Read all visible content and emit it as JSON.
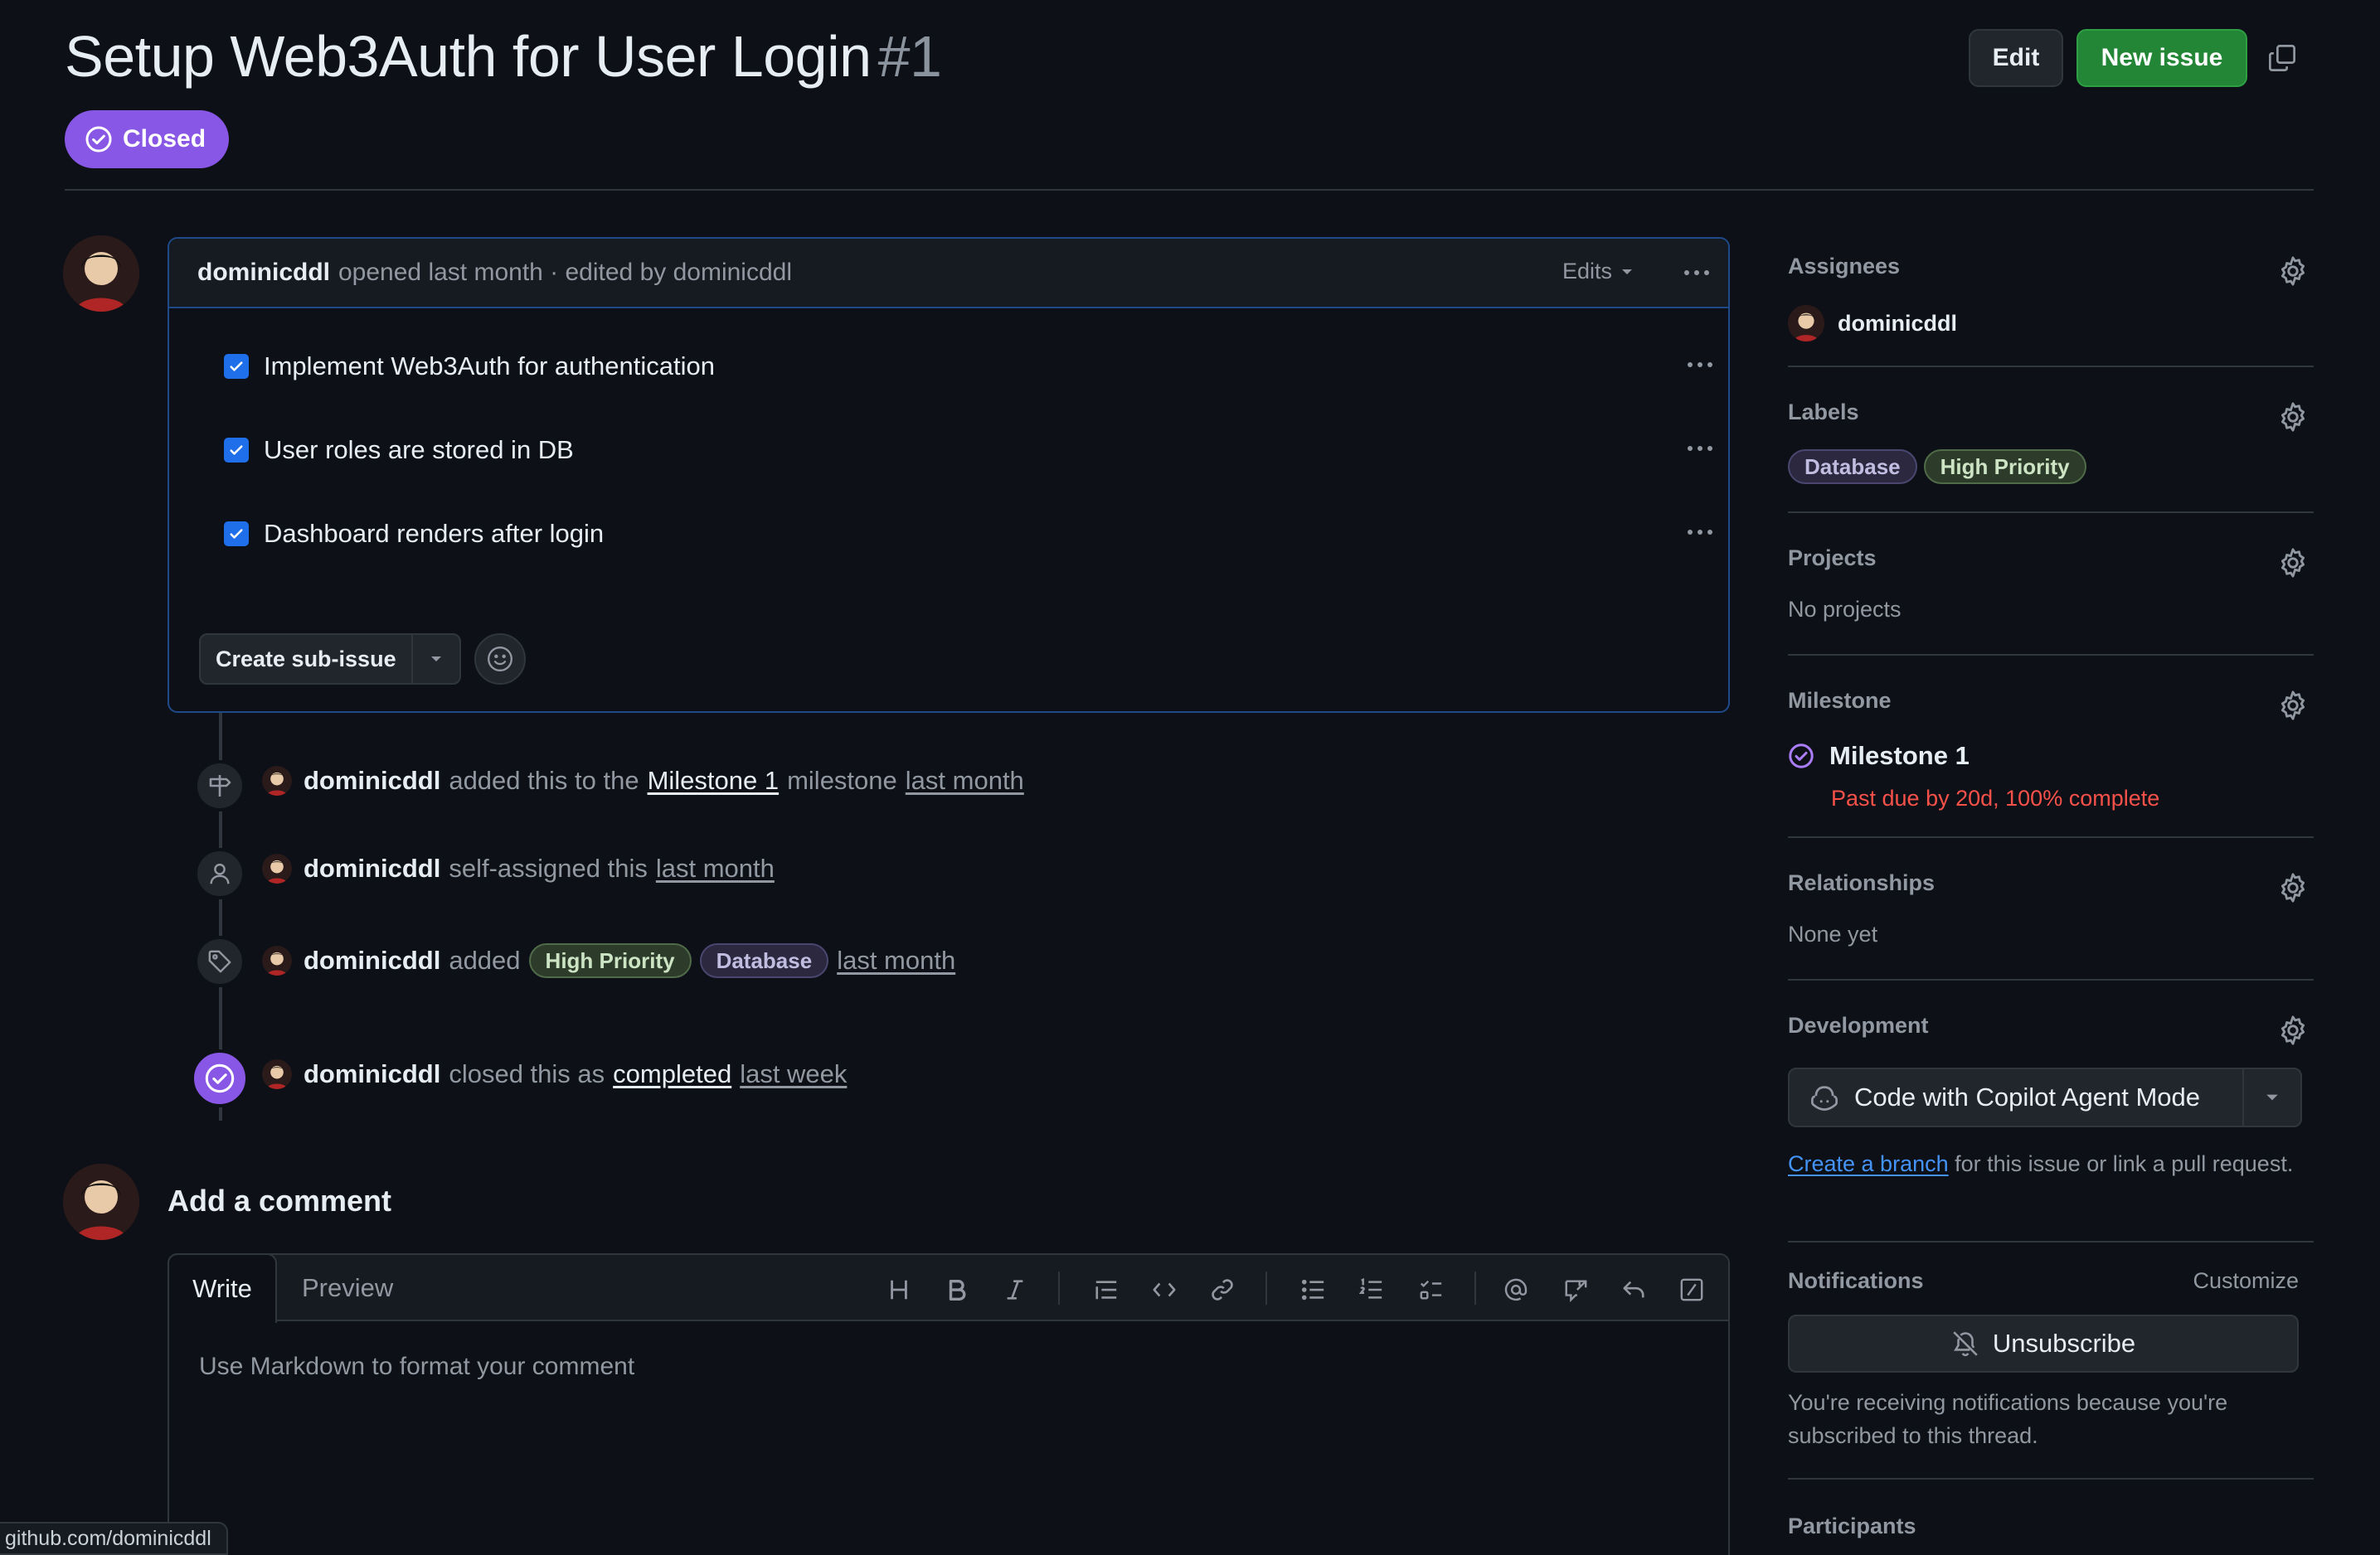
{
  "issue": {
    "title": "Setup Web3Auth for User Login",
    "number": "#1",
    "state": "Closed"
  },
  "header": {
    "edit_label": "Edit",
    "new_issue_label": "New issue"
  },
  "comment": {
    "author": "dominicddl",
    "meta": "opened last month · edited by dominicddl",
    "edits_label": "Edits",
    "tasks": [
      {
        "label": "Implement Web3Auth for authentication",
        "checked": true
      },
      {
        "label": "User roles are stored in DB",
        "checked": true
      },
      {
        "label": "Dashboard renders after login",
        "checked": true
      }
    ],
    "create_sub_issue_label": "Create sub-issue"
  },
  "timeline": {
    "milestone_event": {
      "actor": "dominicddl",
      "text_before": "added this to the",
      "milestone": "Milestone 1",
      "text_after": "milestone",
      "time": "last month"
    },
    "assign_event": {
      "actor": "dominicddl",
      "text": "self-assigned this",
      "time": "last month"
    },
    "label_event": {
      "actor": "dominicddl",
      "text": "added",
      "labels": [
        "High Priority",
        "Database"
      ],
      "time": "last month"
    },
    "close_event": {
      "actor": "dominicddl",
      "text": "closed this as",
      "reason": "completed",
      "time": "last week"
    }
  },
  "add_comment": {
    "title": "Add a comment",
    "tab_write": "Write",
    "tab_preview": "Preview",
    "placeholder": "Use Markdown to format your comment",
    "toolbar_icons": [
      "heading-icon",
      "bold-icon",
      "italic-icon",
      "quote-icon",
      "code-icon",
      "link-icon",
      "unordered-list-icon",
      "ordered-list-icon",
      "task-list-icon",
      "mention-icon",
      "reference-icon",
      "saved-reply-icon",
      "slash-command-icon"
    ]
  },
  "sidebar": {
    "assignees": {
      "title": "Assignees",
      "user": "dominicddl"
    },
    "labels": {
      "title": "Labels",
      "items": [
        "Database",
        "High Priority"
      ]
    },
    "projects": {
      "title": "Projects",
      "value": "No projects"
    },
    "milestone": {
      "title": "Milestone",
      "name": "Milestone 1",
      "status": "Past due by 20d, 100% complete"
    },
    "relationships": {
      "title": "Relationships",
      "value": "None yet"
    },
    "development": {
      "title": "Development",
      "copilot_label": "Code with Copilot Agent Mode",
      "create_branch_link": "Create a branch",
      "create_branch_text": "for this issue or link a pull request."
    },
    "notifications": {
      "title": "Notifications",
      "customize": "Customize",
      "unsubscribe": "Unsubscribe",
      "reason": "You're receiving notifications because you're subscribed to this thread."
    },
    "participants": {
      "title": "Participants"
    }
  },
  "status_bar": {
    "url": "github.com/dominicddl"
  },
  "colors": {
    "closed_purple": "#8957e5",
    "primary_green": "#238636",
    "link_blue": "#4493f8",
    "past_due_red": "#f85149"
  }
}
